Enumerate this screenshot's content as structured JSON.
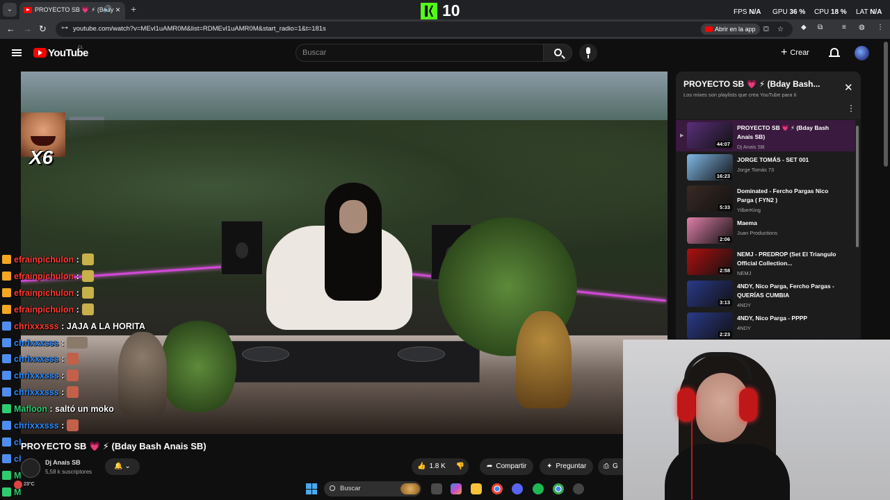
{
  "browser": {
    "tab_menu_icon": "chevron-down-icon",
    "tab_title": "PROYECTO SB 💗 ⚡ (Bday",
    "tab_audio_icon": "speaker-icon",
    "new_tab_label": "+",
    "url": "youtube.com/watch?v=MEvl1uAMR0M&list=RDMEvl1uAMR0M&start_radio=1&t=181s",
    "open_in_app_label": "Abrir en la app",
    "back_icon": "←",
    "forward_icon": "→",
    "reload_icon": "↻",
    "site_info_icon": "⊶"
  },
  "overlay": {
    "kick_count": "10",
    "perf": {
      "fps_label": "FPS",
      "fps_value": "N/A",
      "gpu_label": "GPU",
      "gpu_value": "36 %",
      "cpu_label": "CPU",
      "cpu_value": "18 %",
      "lat_label": "LAT",
      "lat_value": "N/A"
    },
    "emote_multiplier": "X6",
    "weather_temp": "23°C"
  },
  "youtube": {
    "logo_text": "YouTube",
    "country_code": "CL",
    "search_placeholder": "Buscar",
    "create_label": "Crear"
  },
  "chat": [
    {
      "badge": "sub",
      "user": "efrainpichulon",
      "user_color": "#ff3b30",
      "msg": " :",
      "emote": true
    },
    {
      "badge": "sub",
      "user": "efrainpichulon",
      "user_color": "#ff3b30",
      "msg": " :",
      "emote": true
    },
    {
      "badge": "sub",
      "user": "efrainpichulon",
      "user_color": "#ff3b30",
      "msg": " :",
      "emote": true
    },
    {
      "badge": "sub",
      "user": "efrainpichulon",
      "user_color": "#ff3b30",
      "msg": " :",
      "emote": true
    },
    {
      "badge": "vip",
      "user": "chrixxxsss",
      "user_color": "#ff3b30",
      "msg": " : JAJA A LA HORITA",
      "emote": false
    },
    {
      "badge": "vip",
      "user": "chrixxxsss",
      "user_color": "#2d8cff",
      "msg": " :",
      "emote": true
    },
    {
      "badge": "vip",
      "user": "chrixxxsss",
      "user_color": "#2d8cff",
      "msg": " :",
      "emote": true
    },
    {
      "badge": "vip",
      "user": "chrixxxsss",
      "user_color": "#2d8cff",
      "msg": " :",
      "emote": true
    },
    {
      "badge": "vip",
      "user": "chrixxxsss",
      "user_color": "#2d8cff",
      "msg": " :",
      "emote": true
    },
    {
      "badge": "og",
      "user": "Mafloon",
      "user_color": "#2ecc71",
      "msg": " : saltó un moko",
      "emote": false
    },
    {
      "badge": "vip",
      "user": "chrixxxsss",
      "user_color": "#2d8cff",
      "msg": " :",
      "emote": true
    },
    {
      "badge": "vip",
      "user": "chrixxxsss",
      "user_color": "#2d8cff",
      "msg": " :",
      "emote": true
    },
    {
      "badge": "vip",
      "user": "chrixxxsss",
      "user_color": "#2d8cff",
      "msg": " :",
      "emote": true
    },
    {
      "badge": "og",
      "user": "Mafloon",
      "user_color": "#2ecc71",
      "msg": " :",
      "emote": true
    },
    {
      "badge": "og",
      "user": "Mafloon",
      "user_color": "#2ecc71",
      "msg": " :",
      "emote": true
    }
  ],
  "video": {
    "title": "PROYECTO SB 💗 ⚡ (Bday Bash Anais SB)",
    "channel": "Dj Anais SB",
    "subscribers": "5,58 k suscriptores",
    "likes": "1.8 K",
    "share_label": "Compartir",
    "ask_label": "Preguntar",
    "save_label": "G"
  },
  "playlist": {
    "title": "PROYECTO SB 💗 ⚡ (Bday Bash...",
    "subtitle": "Los mixes son playlists que crea YouTube para ti",
    "items": [
      {
        "title": "PROYECTO SB 💗 ⚡ (Bday Bash Anais SB)",
        "channel": "Dj Anais SB",
        "duration": "44:07",
        "thumb_color": "#5a2f7a",
        "active": true
      },
      {
        "title": "JORGE TOMÁS - SET 001",
        "channel": "Jorge Tomás 73",
        "duration": "16:23",
        "thumb_color": "#7fb8e8",
        "active": false
      },
      {
        "title": "Dominated - Fercho Pargas Nico Parga ( FYN2 )",
        "channel": "YilberKing",
        "duration": "5:33",
        "thumb_color": "#3a2a24",
        "active": false
      },
      {
        "title": "Maema",
        "channel": "Juan Productions",
        "duration": "2:06",
        "thumb_color": "#e07fa8",
        "active": false
      },
      {
        "title": "NEMJ - PREDROP (Set El Triangulo Official Collection...",
        "channel": "NEMJ",
        "duration": "2:58",
        "thumb_color": "#b01010",
        "active": false
      },
      {
        "title": "4NDY, Nico Parga, Fercho Pargas - QUERÍAS CUMBIA",
        "channel": "4NDY",
        "duration": "3:13",
        "thumb_color": "#2a3a8a",
        "active": false
      },
      {
        "title": "4NDY, Nico Parga - PPPP",
        "channel": "4NDY",
        "duration": "2:23",
        "thumb_color": "#2a3a8a",
        "active": false
      }
    ]
  },
  "taskbar": {
    "search_placeholder": "Buscar"
  },
  "colors": {
    "youtube_red": "#ff0000",
    "kick_green": "#53fc18",
    "playlist_active": "#3a1a3f"
  }
}
